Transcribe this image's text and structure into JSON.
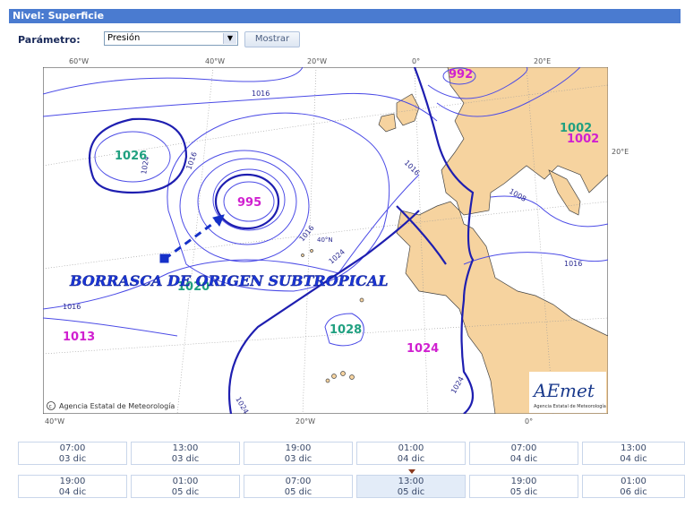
{
  "header": {
    "title": "Nivel: Superficie"
  },
  "parameter": {
    "label": "Parámetro:",
    "selected": "Presión",
    "button": "Mostrar"
  },
  "map": {
    "lon_top": [
      "60°W",
      "40°W",
      "20°W",
      "0°",
      "20°E"
    ],
    "lon_bottom": [
      "40°W",
      "20°W",
      "0°"
    ],
    "lat_labels": [
      "20°E",
      "40°N"
    ],
    "isobar_labels": [
      "1016",
      "1016",
      "1024",
      "1016",
      "1016",
      "1024",
      "1016",
      "1008",
      "1016",
      "1024",
      "1024",
      "1024"
    ],
    "pressure_centers": [
      {
        "value": "992",
        "color": "#d020d0"
      },
      {
        "value": "1002",
        "color": "#20a080"
      },
      {
        "value": "1002",
        "color": "#d020d0"
      },
      {
        "value": "1026",
        "color": "#20a080"
      },
      {
        "value": "995",
        "color": "#d020d0"
      },
      {
        "value": "1020",
        "color": "#20a080"
      },
      {
        "value": "1028",
        "color": "#20a080"
      },
      {
        "value": "1013",
        "color": "#d020d0"
      },
      {
        "value": "1024",
        "color": "#d020d0"
      }
    ],
    "annotation": "BORRASCA DE ORIGEN SUBTROPICAL",
    "credit": "Agencia Estatal de Meteorología",
    "logo": {
      "text": "AEmet",
      "subtitle": "Agencia Estatal de Meteorología"
    }
  },
  "timesteps": [
    {
      "time": "07:00",
      "date": "03 dic"
    },
    {
      "time": "13:00",
      "date": "03 dic"
    },
    {
      "time": "19:00",
      "date": "03 dic"
    },
    {
      "time": "01:00",
      "date": "04 dic"
    },
    {
      "time": "07:00",
      "date": "04 dic"
    },
    {
      "time": "13:00",
      "date": "04 dic"
    },
    {
      "time": "19:00",
      "date": "04 dic"
    },
    {
      "time": "01:00",
      "date": "05 dic"
    },
    {
      "time": "07:00",
      "date": "05 dic"
    },
    {
      "time": "13:00",
      "date": "05 dic"
    },
    {
      "time": "19:00",
      "date": "05 dic"
    },
    {
      "time": "01:00",
      "date": "06 dic"
    }
  ],
  "selected_timestep": 9
}
